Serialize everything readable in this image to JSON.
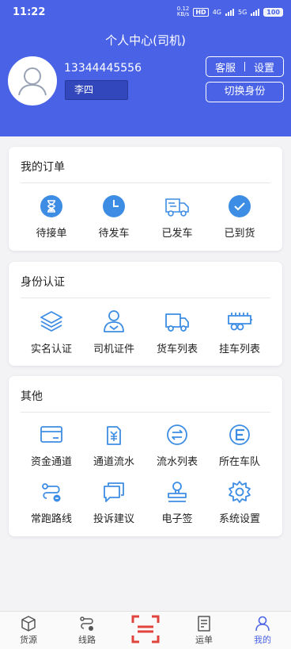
{
  "status_bar": {
    "time": "11:22",
    "net_speed_top": "0.12",
    "net_speed_bottom": "KB/s",
    "hd_badge": "HD",
    "sig1": "4G",
    "sig2": "5G",
    "battery": "100"
  },
  "header": {
    "title": "个人中心(司机)",
    "phone": "13344445556",
    "name": "李四",
    "service_label": "客服",
    "settings_label": "设置",
    "switch_label": "切换身份"
  },
  "orders": {
    "title": "我的订单",
    "items": [
      {
        "label": "待接单",
        "icon": "hourglass-icon"
      },
      {
        "label": "待发车",
        "icon": "clock-icon"
      },
      {
        "label": "已发车",
        "icon": "truck-moving-icon"
      },
      {
        "label": "已到货",
        "icon": "check-circle-icon"
      }
    ]
  },
  "identity": {
    "title": "身份认证",
    "items": [
      {
        "label": "实名认证",
        "icon": "layers-icon"
      },
      {
        "label": "司机证件",
        "icon": "driver-icon"
      },
      {
        "label": "货车列表",
        "icon": "truck-icon"
      },
      {
        "label": "挂车列表",
        "icon": "trailer-icon"
      }
    ]
  },
  "other": {
    "title": "其他",
    "items": [
      {
        "label": "资金通道",
        "icon": "card-icon"
      },
      {
        "label": "通道流水",
        "icon": "yuan-doc-icon"
      },
      {
        "label": "流水列表",
        "icon": "exchange-icon"
      },
      {
        "label": "所在车队",
        "icon": "fleet-icon"
      },
      {
        "label": "常跑路线",
        "icon": "route-icon"
      },
      {
        "label": "投诉建议",
        "icon": "feedback-icon"
      },
      {
        "label": "电子签",
        "icon": "stamp-icon"
      },
      {
        "label": "系统设置",
        "icon": "gear-icon"
      }
    ]
  },
  "tabbar": {
    "items": [
      {
        "label": "货源",
        "icon": "box-icon"
      },
      {
        "label": "线路",
        "icon": "route-icon"
      },
      {
        "label": "",
        "icon": "scan-icon"
      },
      {
        "label": "运单",
        "icon": "waybill-icon"
      },
      {
        "label": "我的",
        "icon": "user-icon"
      }
    ],
    "active": "我的"
  },
  "colors": {
    "primary": "#4a63e6",
    "icon_blue": "#3e8de4",
    "scan_red": "#e1443c"
  }
}
